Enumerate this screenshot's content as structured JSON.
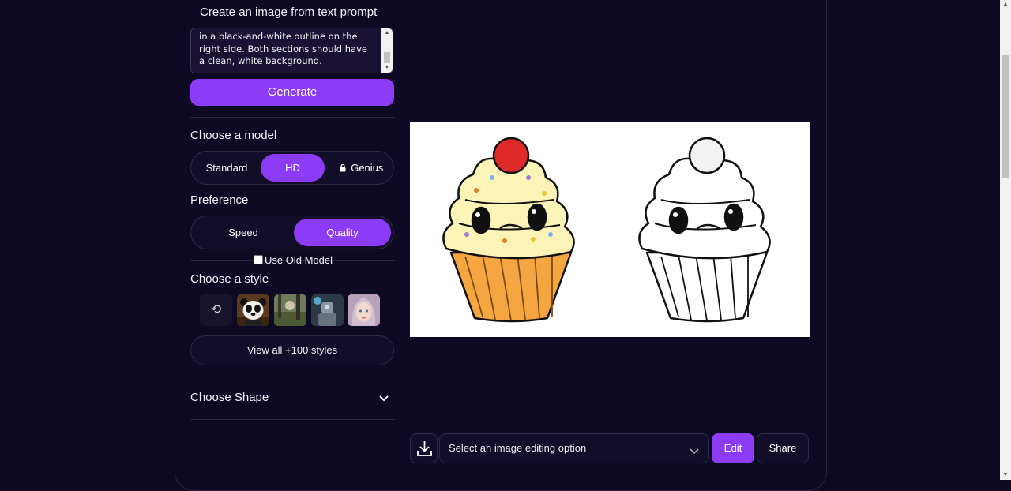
{
  "prompt": {
    "title": "Create an image from text prompt",
    "lines": [
      "in a black-and-white outline on the",
      "right side. Both sections should have",
      "a clean, white background."
    ]
  },
  "generate_label": "Generate",
  "model": {
    "title": "Choose a model",
    "options": [
      "Standard",
      "HD",
      "Genius"
    ],
    "selected": "HD"
  },
  "preference": {
    "title": "Preference",
    "options": [
      "Speed",
      "Quality"
    ],
    "selected": "Quality"
  },
  "old_model_label": "Use Old Model",
  "style": {
    "title": "Choose a style",
    "thumbs": [
      "panda",
      "forest",
      "armored robot",
      "fantasy portrait"
    ],
    "view_all_label": "View all +100 styles"
  },
  "shape": {
    "title": "Choose Shape"
  },
  "actions": {
    "edit_select_label": "Select an image editing option",
    "edit_label": "Edit",
    "share_label": "Share"
  },
  "colors": {
    "accent": "#8c3cf6",
    "background": "#0f0a24"
  }
}
